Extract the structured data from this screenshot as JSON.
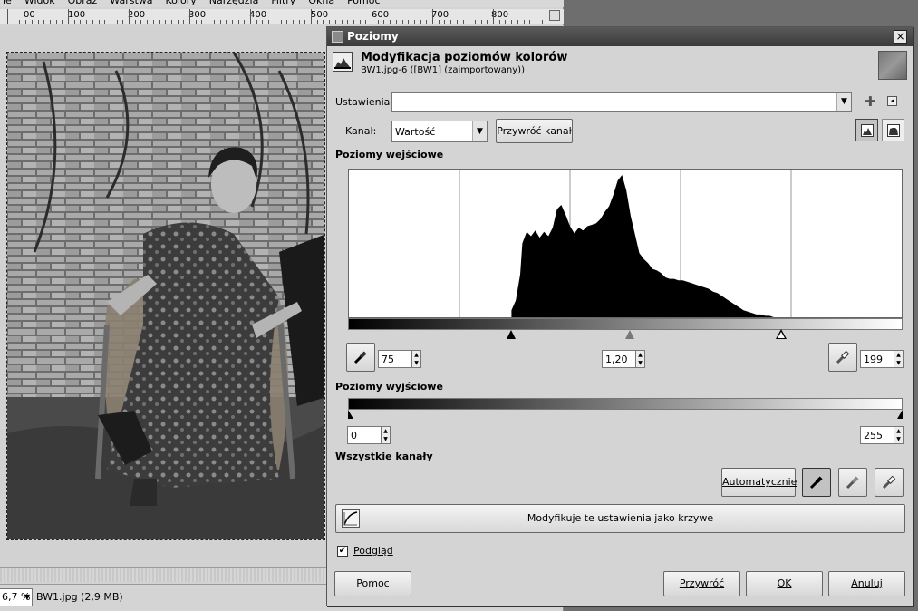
{
  "gimp": {
    "menu": [
      "le",
      "Widok",
      "Obraz",
      "Warstwa",
      "Kolory",
      "Narzędzia",
      "Filtry",
      "Okna",
      "Pomoc"
    ],
    "ruler_labels": [
      "00",
      "100",
      "200",
      "300",
      "400",
      "500",
      "600",
      "700",
      "800"
    ],
    "zoom": "6,7 %",
    "status": "BW1.jpg (2,9 MB)"
  },
  "dialog": {
    "window_title": "Poziomy",
    "close_glyph": "×",
    "header_title": "Modyfikacja poziomów kolorów",
    "header_subtitle": "BW1.jpg-6 ([BW1] (zaimportowany))",
    "settings_label": "Ustawienia:",
    "settings_value": "",
    "add_preset_glyph": "✚",
    "preset_menu_glyph": "◂",
    "channel_label": "Kanał:",
    "channel_value": "Wartość",
    "reset_channel": "Przywróć kanał",
    "input_levels_title": "Poziomy wejściowe",
    "input_low": "75",
    "input_gamma": "1,20",
    "input_high": "199",
    "output_levels_title": "Poziomy wyjściowe",
    "output_low": "0",
    "output_high": "255",
    "all_channels_title": "Wszystkie kanały",
    "auto_button": "Automatycznie",
    "edit_as_curves": "Modyfikuje te ustawienia jako krzywe",
    "preview_label": "Podgląd",
    "preview_checked": true,
    "help_button": "Pomoc",
    "reset_button": "Przywróć",
    "ok_button": "OK",
    "cancel_button": "Anuluj"
  },
  "chart_data": {
    "type": "area",
    "x_range": [
      0,
      255
    ],
    "input_low": 75,
    "input_gamma": 1.2,
    "input_high": 199,
    "grid_vertical_lines": 4,
    "x": [
      75,
      77,
      79,
      80,
      82,
      84,
      86,
      88,
      90,
      92,
      94,
      96,
      98,
      100,
      102,
      104,
      106,
      108,
      110,
      112,
      114,
      116,
      118,
      120,
      122,
      124,
      126,
      128,
      130,
      132,
      134,
      136,
      138,
      140,
      142,
      144,
      146,
      148,
      150,
      152,
      154,
      156,
      158,
      160,
      162,
      164,
      166,
      168,
      170,
      172,
      174,
      176,
      178,
      180,
      182,
      184,
      186,
      188,
      190,
      192,
      194,
      196,
      198,
      200
    ],
    "y": [
      0.05,
      0.12,
      0.3,
      0.52,
      0.6,
      0.57,
      0.61,
      0.56,
      0.6,
      0.57,
      0.63,
      0.76,
      0.79,
      0.72,
      0.64,
      0.59,
      0.63,
      0.61,
      0.64,
      0.65,
      0.66,
      0.69,
      0.74,
      0.78,
      0.86,
      0.96,
      1.0,
      0.89,
      0.71,
      0.58,
      0.45,
      0.41,
      0.38,
      0.34,
      0.33,
      0.31,
      0.28,
      0.27,
      0.27,
      0.26,
      0.26,
      0.25,
      0.24,
      0.23,
      0.22,
      0.21,
      0.2,
      0.18,
      0.17,
      0.15,
      0.13,
      0.11,
      0.09,
      0.07,
      0.05,
      0.04,
      0.03,
      0.02,
      0.02,
      0.01,
      0.01,
      0.0,
      0.0,
      0.0
    ]
  },
  "colors": {
    "dialog_bg": "#d4d4d4",
    "titlebar": "#3a3a3a",
    "histogram": "#000000"
  }
}
